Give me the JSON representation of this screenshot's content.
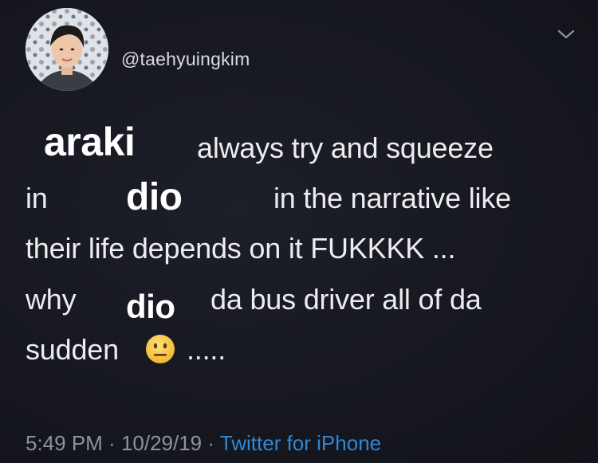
{
  "tweet": {
    "handle": "@taehyuingkim",
    "lines": {
      "l1": "always try and squeeze",
      "l2a": "in",
      "l2b": "in the narrative like",
      "l3": "their life depends on it FUKKKK ...",
      "l4a": "why",
      "l4b": "da bus driver all of da",
      "l5a": "sudden",
      "l5b": "....."
    },
    "overlays": {
      "araki": "araki",
      "dio1": "dio",
      "dio2": "dio"
    },
    "emoji": "neutral-face-emoji",
    "footer": {
      "time": "5:49 PM",
      "separator1": " · ",
      "date": "10/29/19",
      "separator2": " · ",
      "source": "Twitter for iPhone"
    }
  },
  "colors": {
    "background": "#16171f",
    "text": "#ededf0",
    "muted": "#8f929b",
    "link": "#2e86d6"
  }
}
